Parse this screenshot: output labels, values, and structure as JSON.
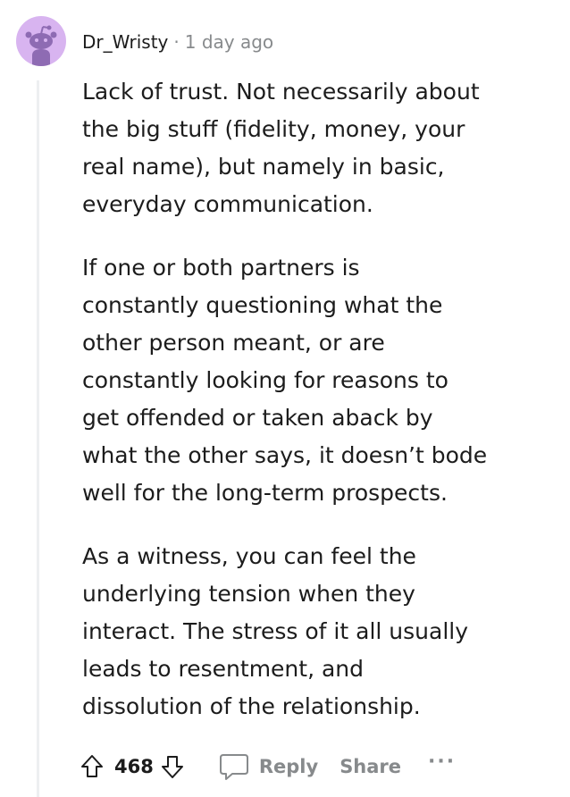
{
  "comment": {
    "username": "Dr_Wristy",
    "separator": "·",
    "timestamp": "1 day ago",
    "paragraphs": [
      "Lack of trust. Not necessarily about\nthe big stuff (fidelity, money, your\nreal name), but namely in basic,\neveryday communication.",
      "If one or both partners is\nconstantly questioning what the\nother person meant, or are\nconstantly looking for reasons to\nget offended or taken aback by\nwhat the other says, it doesn’t bode\nwell for the long-term prospects.",
      "As a witness, you can feel the\nunderlying tension when they\ninteract. The stress of it all usually\nleads to resentment, and\ndissolution of the relationship."
    ],
    "votes": "468",
    "reply_label": "Reply",
    "share_label": "Share",
    "more_label": "···"
  },
  "icons": {
    "avatar": "reddit-snoo-avatar",
    "upvote": "upvote-arrow-icon",
    "downvote": "downvote-arrow-icon",
    "reply": "speech-bubble-icon"
  },
  "colors": {
    "avatar_bg": "#d8b4f0",
    "avatar_figure": "#8e6bb3",
    "muted_text": "#878a8c",
    "thread_line": "#edeff1"
  }
}
